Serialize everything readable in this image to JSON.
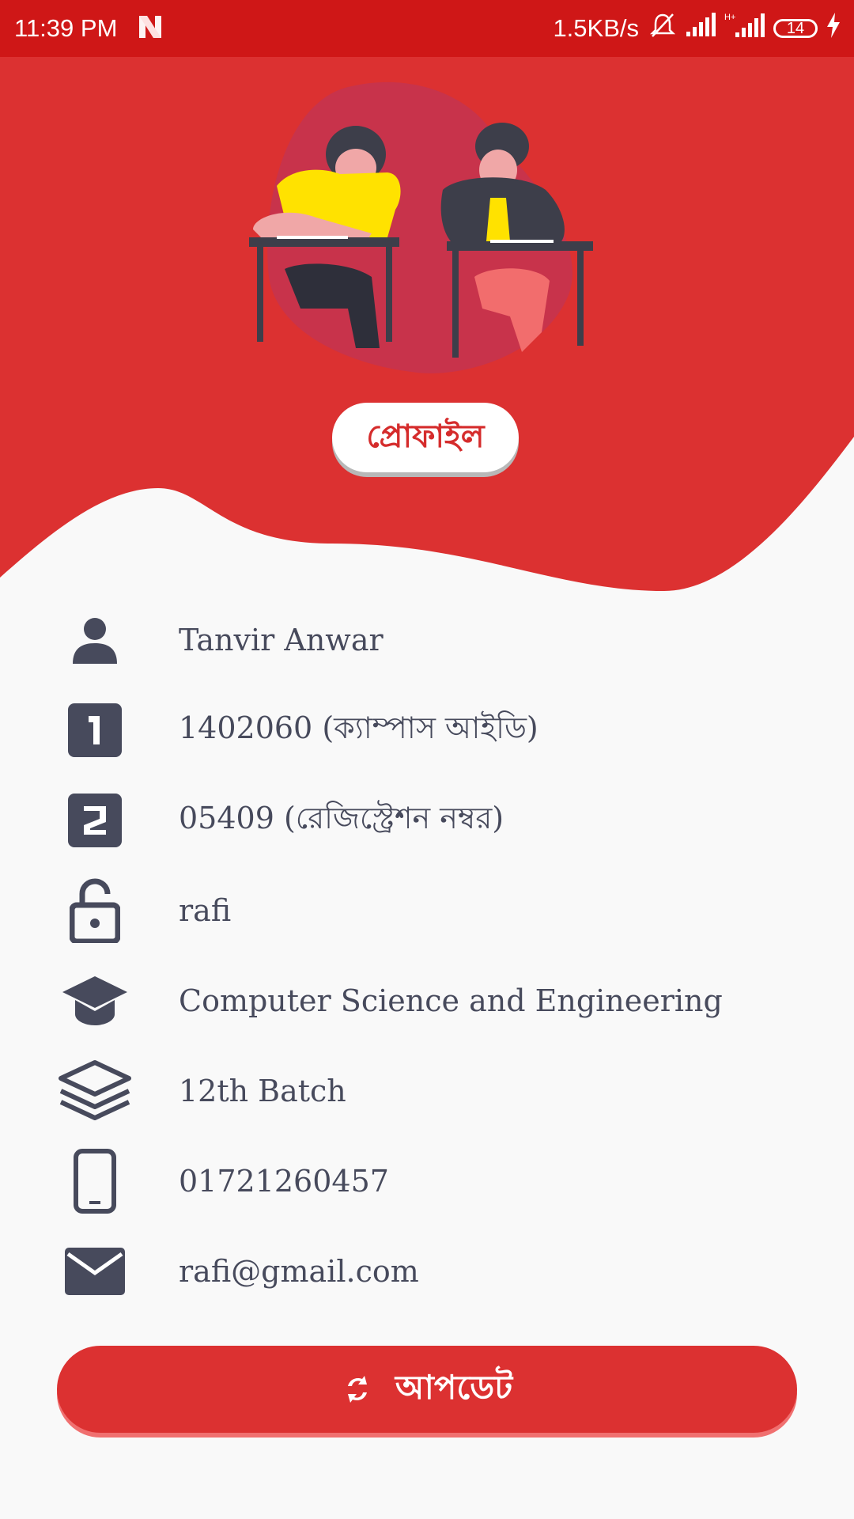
{
  "status_bar": {
    "time": "11:39 PM",
    "network_speed": "1.5KB/s",
    "battery": "14",
    "icons": [
      "notification-n-icon",
      "mute-icon",
      "signal-icon",
      "hplus-signal-icon",
      "battery-icon",
      "charging-icon"
    ]
  },
  "colors": {
    "primary_red": "#dc3131",
    "status_bar_red": "#cf1717",
    "text_dark": "#474a5c",
    "background": "#f9f9f9"
  },
  "header": {
    "profile_label": "প্রোফাইল"
  },
  "profile": {
    "name": "Tanvir Anwar",
    "campus_id": "1402060 (ক্যাম্পাস আইডি)",
    "registration": "05409 (রেজিস্ট্রেশন নম্বর)",
    "password": "rafi",
    "department": "Computer Science and Engineering",
    "batch": "12th Batch",
    "phone": "01721260457",
    "email": "rafi@gmail.com"
  },
  "actions": {
    "update_label": "আপডেট"
  }
}
